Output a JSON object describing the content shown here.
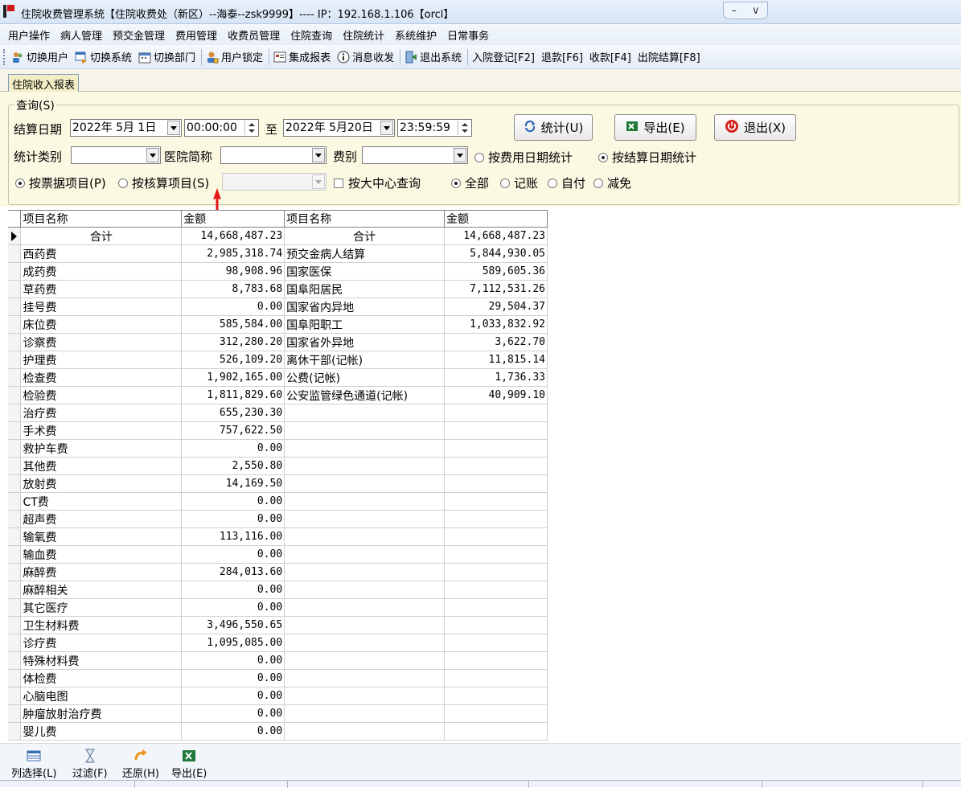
{
  "window": {
    "title": "住院收费管理系统【住院收费处（新区）--海泰--zsk9999】---- IP：192.168.1.106【orcl】"
  },
  "menu": [
    "用户操作",
    "病人管理",
    "预交金管理",
    "费用管理",
    "收费员管理",
    "住院查询",
    "住院统计",
    "系统维护",
    "日常事务"
  ],
  "toolbar": {
    "switch_user": "切换用户",
    "switch_system": "切换系统",
    "switch_dept": "切换部门",
    "user_lock": "用户锁定",
    "report": "集成报表",
    "message": "消息收发",
    "exit_system": "退出系统",
    "admission": "入院登记[F2]",
    "refund": "退款[F6]",
    "charge": "收款[F4]",
    "discharge": "出院结算[F8]"
  },
  "tab": {
    "label": "住院收入报表"
  },
  "query": {
    "legend": "查询(S)",
    "settle_date_label": "结算日期",
    "date_from": "2022年 5月 1日",
    "time_from": "00:00:00",
    "to_label": "至",
    "date_to": "2022年 5月20日",
    "time_to": "23:59:59",
    "stat_category_label": "统计类别",
    "hospital_label": "医院简称",
    "fee_type_label": "费别",
    "by_fee_date": "按费用日期统计",
    "by_settle_date": "按结算日期统计",
    "by_invoice_item": "按票据项目(P)",
    "by_account_item": "按核算项目(S)",
    "by_center": "按大中心查询",
    "all": "全部",
    "bookkeeping": "记账",
    "self_pay": "自付",
    "waiver": "减免",
    "stat_button": "统计(U)",
    "export_button": "导出(E)",
    "exit_button": "退出(X)"
  },
  "grid": {
    "headers": [
      "项目名称",
      "金额",
      "项目名称",
      "金额"
    ],
    "rows": [
      [
        "合计",
        "14,668,487.23",
        "合计",
        "14,668,487.23"
      ],
      [
        "西药费",
        "2,985,318.74",
        "预交金病人结算",
        "5,844,930.05"
      ],
      [
        "成药费",
        "98,908.96",
        "国家医保",
        "589,605.36"
      ],
      [
        "草药费",
        "8,783.68",
        "国阜阳居民",
        "7,112,531.26"
      ],
      [
        "挂号费",
        "0.00",
        "国家省内异地",
        "29,504.37"
      ],
      [
        "床位费",
        "585,584.00",
        "国阜阳职工",
        "1,033,832.92"
      ],
      [
        "诊察费",
        "312,280.20",
        "国家省外异地",
        "3,622.70"
      ],
      [
        "护理费",
        "526,109.20",
        "离休干部(记帐)",
        "11,815.14"
      ],
      [
        "检查费",
        "1,902,165.00",
        "公费(记帐)",
        "1,736.33"
      ],
      [
        "检验费",
        "1,811,829.60",
        "公安监管绿色通道(记帐)",
        "40,909.10"
      ],
      [
        "治疗费",
        "655,230.30",
        "",
        ""
      ],
      [
        "手术费",
        "757,622.50",
        "",
        ""
      ],
      [
        "救护车费",
        "0.00",
        "",
        ""
      ],
      [
        "其他费",
        "2,550.80",
        "",
        ""
      ],
      [
        "放射费",
        "14,169.50",
        "",
        ""
      ],
      [
        "CT费",
        "0.00",
        "",
        ""
      ],
      [
        "超声费",
        "0.00",
        "",
        ""
      ],
      [
        "输氧费",
        "113,116.00",
        "",
        ""
      ],
      [
        "输血费",
        "0.00",
        "",
        ""
      ],
      [
        "麻醉费",
        "284,013.60",
        "",
        ""
      ],
      [
        "麻醉相关",
        "0.00",
        "",
        ""
      ],
      [
        "其它医疗",
        "0.00",
        "",
        ""
      ],
      [
        "卫生材料费",
        "3,496,550.65",
        "",
        ""
      ],
      [
        "诊疗费",
        "1,095,085.00",
        "",
        ""
      ],
      [
        "特殊材料费",
        "0.00",
        "",
        ""
      ],
      [
        "体检费",
        "0.00",
        "",
        ""
      ],
      [
        "心脑电图",
        "0.00",
        "",
        ""
      ],
      [
        "肿瘤放射治疗费",
        "0.00",
        "",
        ""
      ],
      [
        "婴儿费",
        "0.00",
        "",
        ""
      ]
    ]
  },
  "bottom": {
    "column_select": "列选择(L)",
    "filter": "过滤(F)",
    "restore": "还原(H)",
    "export": "导出(E)"
  }
}
